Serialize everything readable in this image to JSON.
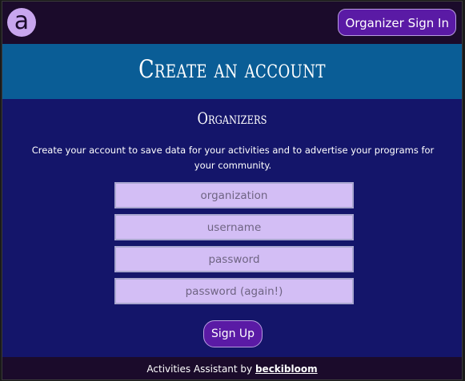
{
  "header": {
    "logo_text": "a",
    "signin_label": "Organizer Sign In"
  },
  "banner": {
    "title": "Create an account"
  },
  "section": {
    "title": "Organizers",
    "description": "Create your account to save data for your activities and to advertise your programs for your community."
  },
  "form": {
    "organization_placeholder": "organization",
    "username_placeholder": "username",
    "password_placeholder": "password",
    "password_again_placeholder": "password (again!)",
    "submit_label": "Sign Up"
  },
  "footer": {
    "text": "Activities Assistant by ",
    "link_text": "beckibloom"
  },
  "colors": {
    "page_bg": "#14156a",
    "topbar_bg": "#1b0b2b",
    "banner_bg": "#0a5d96",
    "button_bg": "#5a1aa5",
    "field_bg": "#d3bef5"
  }
}
